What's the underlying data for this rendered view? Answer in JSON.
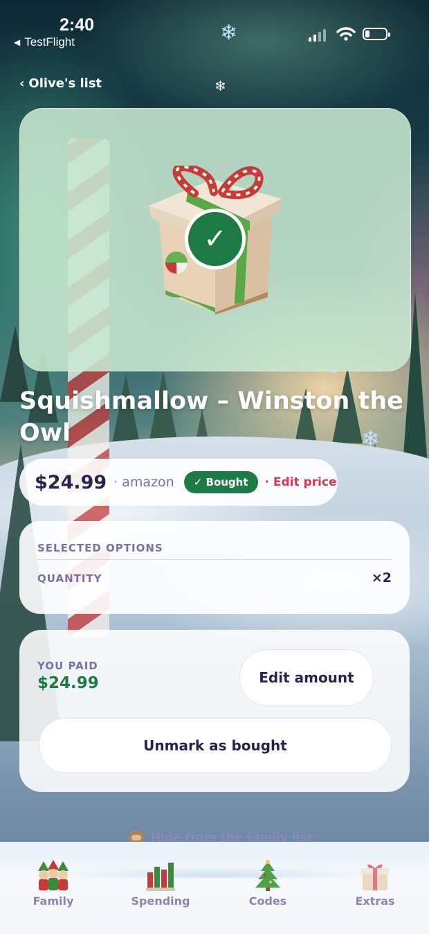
{
  "status_bar": {
    "time": "2:40",
    "back_app": "TestFlight"
  },
  "nav": {
    "back_label": "Olive's list"
  },
  "item": {
    "title": "Squishmallow – Winston the Owl",
    "price": "$24.99",
    "store": "· amazon",
    "status_badge": "✓ Bought",
    "edit_price_label": "· Edit price",
    "checkmark": "✓"
  },
  "options": {
    "header": "SELECTED OPTIONS",
    "rows": [
      {
        "label": "QUANTITY",
        "value": "×2"
      }
    ]
  },
  "payment": {
    "label": "YOU PAID",
    "amount": "$24.99",
    "edit_amount_label": "Edit amount",
    "unmark_label": "Unmark as bought"
  },
  "hide_link": {
    "label": "Hide from the family list"
  },
  "tabs": [
    {
      "label": "Family",
      "icon": "elves-icon"
    },
    {
      "label": "Spending",
      "icon": "candles-icon"
    },
    {
      "label": "Codes",
      "icon": "christmas-tree-icon"
    },
    {
      "label": "Extras",
      "icon": "gift-icon"
    }
  ],
  "colors": {
    "accent_green": "#1e7a45",
    "accent_red": "#d23a55",
    "text_dark": "#2a2350",
    "text_muted": "#7b6fa8"
  }
}
